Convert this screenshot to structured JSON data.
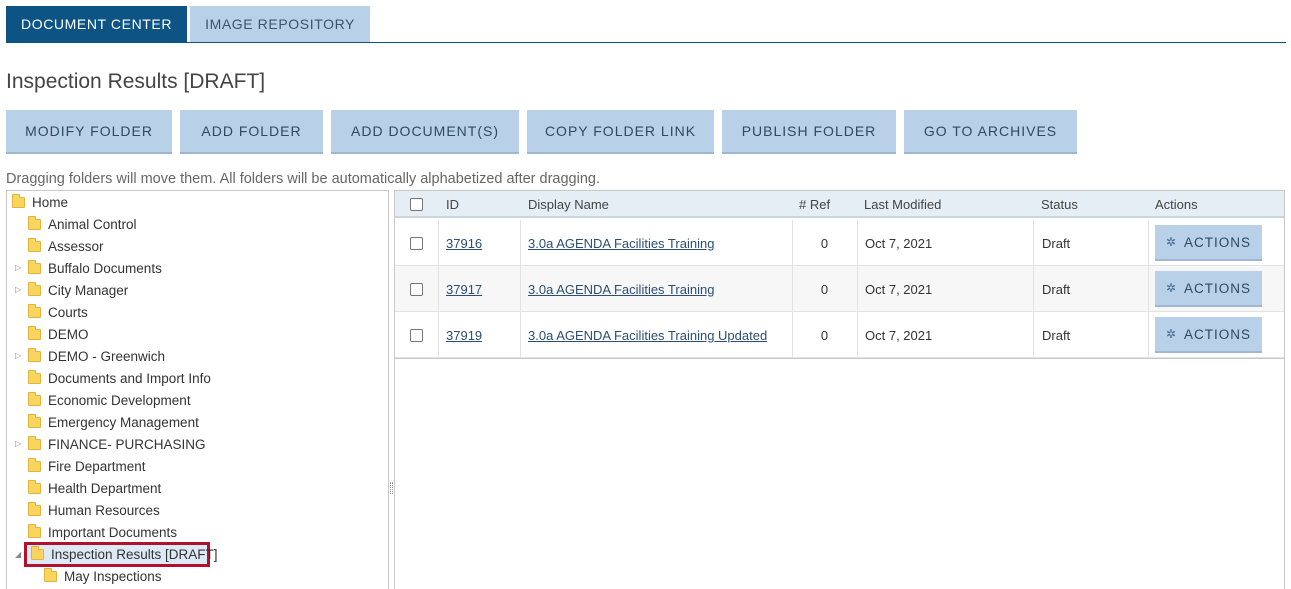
{
  "tabs": [
    {
      "label": "DOCUMENT CENTER",
      "active": true
    },
    {
      "label": "IMAGE REPOSITORY",
      "active": false
    }
  ],
  "page_title": "Inspection Results [DRAFT]",
  "toolbar": {
    "modify_folder": "MODIFY FOLDER",
    "add_folder": "ADD FOLDER",
    "add_documents": "ADD DOCUMENT(S)",
    "copy_folder_link": "COPY FOLDER LINK",
    "publish_folder": "PUBLISH FOLDER",
    "go_to_archives": "GO TO ARCHIVES"
  },
  "hint": "Dragging folders will move them. All folders will be automatically alphabetized after dragging.",
  "tree": {
    "root": "Home",
    "items": [
      {
        "label": "Animal Control",
        "expandable": false
      },
      {
        "label": "Assessor",
        "expandable": false
      },
      {
        "label": "Buffalo Documents",
        "expandable": true
      },
      {
        "label": "City Manager",
        "expandable": true
      },
      {
        "label": "Courts",
        "expandable": false
      },
      {
        "label": "DEMO",
        "expandable": false
      },
      {
        "label": "DEMO - Greenwich",
        "expandable": true
      },
      {
        "label": "Documents and Import Info",
        "expandable": false
      },
      {
        "label": "Economic Development",
        "expandable": false
      },
      {
        "label": "Emergency Management",
        "expandable": false
      },
      {
        "label": "FINANCE- PURCHASING",
        "expandable": true
      },
      {
        "label": "Fire Department",
        "expandable": false
      },
      {
        "label": "Health Department",
        "expandable": false
      },
      {
        "label": "Human Resources",
        "expandable": false
      },
      {
        "label": "Important Documents",
        "expandable": false
      }
    ],
    "selected": "Inspection Results [DRAFT]",
    "child": "May Inspections"
  },
  "grid": {
    "headers": {
      "id": "ID",
      "display_name": "Display Name",
      "ref": "# Ref",
      "last_modified": "Last Modified",
      "status": "Status",
      "actions": "Actions"
    },
    "rows": [
      {
        "id": "37916",
        "name": "3.0a AGENDA Facilities Training",
        "ref": "0",
        "modified": "Oct 7, 2021",
        "status": "Draft",
        "action": "ACTIONS"
      },
      {
        "id": "37917",
        "name": "3.0a AGENDA Facilities Training",
        "ref": "0",
        "modified": "Oct 7, 2021",
        "status": "Draft",
        "action": "ACTIONS"
      },
      {
        "id": "37919",
        "name": "3.0a AGENDA Facilities Training Updated",
        "ref": "0",
        "modified": "Oct 7, 2021",
        "status": "Draft",
        "action": "ACTIONS"
      }
    ]
  },
  "colors": {
    "accent": "#0d5485",
    "button": "#b8d0e8",
    "highlight": "#b2102f"
  }
}
